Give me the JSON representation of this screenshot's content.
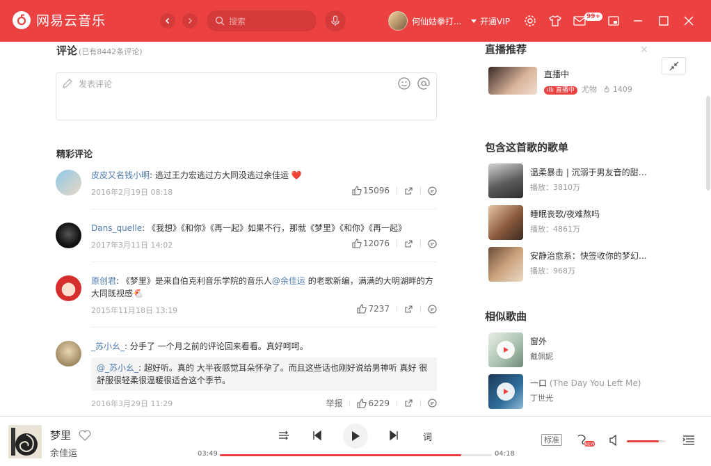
{
  "app": {
    "title": "网易云音乐"
  },
  "search": {
    "placeholder": "搜索"
  },
  "user": {
    "name": "何仙姑拳打..."
  },
  "vip": {
    "label": "开通VIP"
  },
  "badge": {
    "count": "99+"
  },
  "comments": {
    "title": "评论",
    "count": "(已有8442条评论)",
    "input_placeholder": "发表评论",
    "featured_title": "精彩评论",
    "items": [
      {
        "user": "皮皮又名钱小明",
        "sep": ": ",
        "text": "逃过王力宏逃过方大同没逃过余佳运 ❤️",
        "time": "2016年2月19日 08:18",
        "likes": "15096"
      },
      {
        "user": "Dans_quelle",
        "sep": ": ",
        "text": "《我想》《和你》《再一起》如果不行，那就《梦里》《和你》《再一起》",
        "time": "2017年3月11日 14:02",
        "likes": "12076"
      },
      {
        "user": "原创君",
        "sep": ": ",
        "text1": "《梦里》是来自伯克利音乐学院的音乐人",
        "at": "@余佳运",
        "text2": " 的老歌新编，满满的大明湖畔的方大同既视感🐔",
        "time": "2015年11月18日 13:19",
        "likes": "7237"
      },
      {
        "user": "_苏小幺_",
        "sep": ": ",
        "text": "分手了 一个月之前的评论回来看看。真好呵呵。",
        "reply_user": "@_苏小幺_",
        "reply_text": ": 超好听。真的 大半夜感觉耳朵怀孕了。而且这些话也刚好说给男神听 真好 很舒服很轻柔很温暖很适合这个季节。",
        "time": "2016年3月29日 11:29",
        "report": "举报",
        "likes": "6229"
      }
    ]
  },
  "live": {
    "title": "直播推荐",
    "item": {
      "name": "直播中",
      "tag": "直播中",
      "host": "尤物",
      "viewers": "1409"
    }
  },
  "playlists": {
    "title": "包含这首歌的歌单",
    "items": [
      {
        "name": "温柔暴击 | 沉溺于男友音的甜蜜中",
        "plays": "播放：3810万"
      },
      {
        "name": "睡眠丧歌/夜难熬吗",
        "plays": "播放：4861万"
      },
      {
        "name": "安静治愈系：快签收你的梦幻...",
        "plays": "播放：968万"
      }
    ]
  },
  "similar": {
    "title": "相似歌曲",
    "items": [
      {
        "name": "窗外",
        "artist": "戴佩妮"
      },
      {
        "name": "一口",
        "alias": "(The Day You Left Me)",
        "artist": "丁世光"
      }
    ]
  },
  "player": {
    "song": "梦里",
    "artist": "余佳运",
    "current": "03:49",
    "total": "04:18",
    "progress": 0.888,
    "volume": 0.82,
    "lyrics_label": "词",
    "quality": "标准"
  },
  "colors": {
    "brand": "#ec4141",
    "link": "#507daf"
  }
}
